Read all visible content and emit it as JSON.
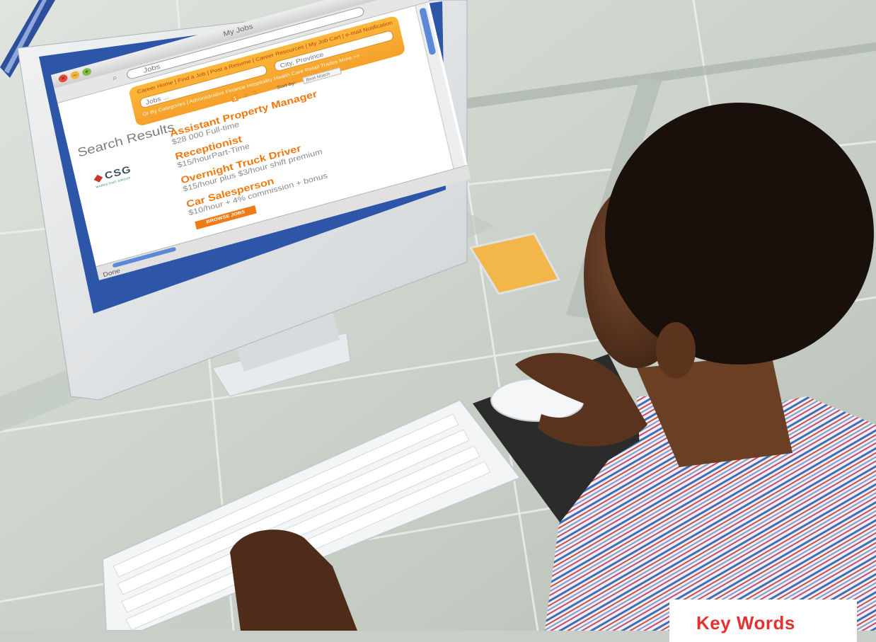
{
  "browser": {
    "window_title": "My Jobs",
    "address_text": "Jobs",
    "status_text": "Done"
  },
  "site": {
    "nav_links": "Career Home | Find a Job | Post a Resume | Career Resources | My Job Cart | e-mail Notification",
    "keyword_placeholder": "Jobs ...",
    "location_placeholder": "City, Province",
    "categories_text": "Or By Categories | Administrative Finance Hospitality Health Care Retail Trades More >>",
    "sort_label": "Sort by:",
    "sort_value": "Best Match",
    "pages": [
      "1",
      "2",
      "3"
    ],
    "results_heading": "Search Results",
    "company_logo_text": "CSG",
    "company_logo_subtext": "MARKETING GROUP",
    "jobs": [
      {
        "title": "Assistant Property Manager",
        "detail": "$28 000 Full-time"
      },
      {
        "title": "Receptionist",
        "detail": "$15/hourPart-Time"
      },
      {
        "title": "Overnight Truck Driver",
        "detail": "$15/hour plus $3/hour shift premium"
      },
      {
        "title": "Car Salesperson",
        "detail": "$10/hour + 4% commission + bonus"
      }
    ],
    "browse_button": "BROWSE JOBS"
  },
  "overlay": {
    "keyword_label": "Key Words"
  },
  "colors": {
    "accent_orange": "#f5a02a",
    "job_title_orange": "#f0780c",
    "monitor_frame_blue": "#2d56a8",
    "keyword_red": "#e5312f"
  }
}
